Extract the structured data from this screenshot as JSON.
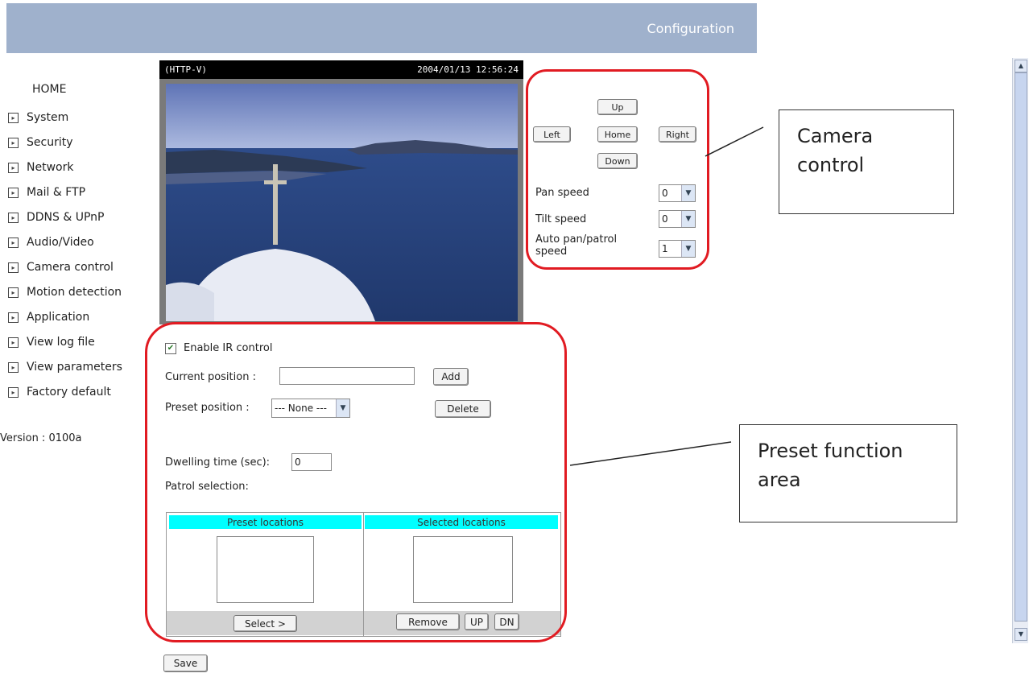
{
  "header": {
    "title": "Configuration"
  },
  "sidebar": {
    "home": "HOME",
    "items": [
      {
        "label": "System"
      },
      {
        "label": "Security"
      },
      {
        "label": "Network"
      },
      {
        "label": "Mail & FTP"
      },
      {
        "label": "DDNS & UPnP"
      },
      {
        "label": "Audio/Video"
      },
      {
        "label": "Camera control"
      },
      {
        "label": "Motion detection"
      },
      {
        "label": "Application"
      },
      {
        "label": "View log file"
      },
      {
        "label": "View parameters"
      },
      {
        "label": "Factory default"
      }
    ],
    "version": "Version : 0100a"
  },
  "video": {
    "overlay_left": "(HTTP-V)",
    "timestamp": "2004/01/13 12:56:24"
  },
  "camera_control": {
    "up": "Up",
    "left": "Left",
    "home": "Home",
    "right": "Right",
    "down": "Down",
    "pan_speed_label": "Pan speed",
    "pan_speed_value": "0",
    "tilt_speed_label": "Tilt speed",
    "tilt_speed_value": "0",
    "auto_pan_label_1": "Auto pan/patrol",
    "auto_pan_label_2": "speed",
    "auto_pan_value": "1"
  },
  "preset": {
    "enable_ir_label": "Enable IR control",
    "enable_ir_checked": true,
    "current_position_label": "Current position :",
    "current_position_value": "",
    "add_label": "Add",
    "preset_position_label": "Preset position :",
    "preset_position_value": "--- None ---",
    "delete_label": "Delete",
    "dwelling_label": "Dwelling time (sec):",
    "dwelling_value": "0",
    "patrol_label": "Patrol selection:",
    "col_preset": "Preset locations",
    "col_selected": "Selected locations",
    "select_label": "Select >",
    "remove_label": "Remove",
    "up_label": "UP",
    "dn_label": "DN"
  },
  "save_label": "Save",
  "callouts": {
    "camera_1": "Camera",
    "camera_2": "control",
    "preset_1": "Preset function",
    "preset_2": "area"
  },
  "colors": {
    "accent": "#e11b22",
    "header": "#9fb1cc",
    "table_header": "#00ffff"
  }
}
